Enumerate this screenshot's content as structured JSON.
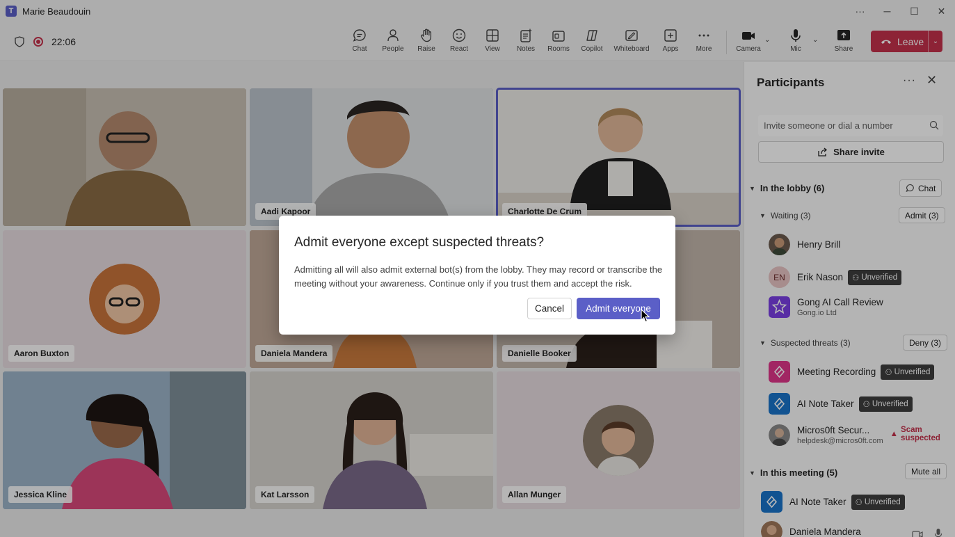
{
  "window": {
    "title": "Marie Beaudouin",
    "app_icon": "T"
  },
  "toolbar": {
    "timer": "22:06",
    "items": [
      {
        "id": "chat",
        "label": "Chat"
      },
      {
        "id": "people",
        "label": "People"
      },
      {
        "id": "raise",
        "label": "Raise"
      },
      {
        "id": "react",
        "label": "React"
      },
      {
        "id": "view",
        "label": "View"
      },
      {
        "id": "notes",
        "label": "Notes"
      },
      {
        "id": "rooms",
        "label": "Rooms"
      },
      {
        "id": "copilot",
        "label": "Copilot"
      },
      {
        "id": "whiteboard",
        "label": "Whiteboard"
      },
      {
        "id": "apps",
        "label": "Apps"
      },
      {
        "id": "more",
        "label": "More"
      },
      {
        "id": "camera",
        "label": "Camera"
      },
      {
        "id": "mic",
        "label": "Mic"
      },
      {
        "id": "share",
        "label": "Share"
      }
    ],
    "leave_label": "Leave",
    "accent": "#c4314b"
  },
  "stage": {
    "tiles": [
      {
        "name": "",
        "bg": "#a89a85"
      },
      {
        "name": "Aadi Kapoor",
        "bg": "#8a8f94"
      },
      {
        "name": "Charlotte De Crum",
        "bg": "#d9d6cf"
      },
      {
        "name": "Aaron Buxton",
        "bg": "#e6dcdf"
      },
      {
        "name": "Daniela Mandera",
        "bg": "#b59a86"
      },
      {
        "name": "Danielle Booker",
        "bg": "#9d8a7d"
      },
      {
        "name": "Jessica Kline",
        "bg": "#8fa3b8"
      },
      {
        "name": "Kat Larsson",
        "bg": "#c9c4bf"
      },
      {
        "name": "Allan Munger",
        "bg": "#e6dcdf"
      }
    ]
  },
  "participants": {
    "title": "Participants",
    "invite_placeholder": "Invite someone or dial a number",
    "share_invite": "Share invite",
    "lobby": {
      "label": "In the lobby (6)",
      "chat_label": "Chat",
      "waiting": {
        "label": "Waiting (3)",
        "action": "Admit (3)",
        "people": [
          {
            "name": "Henry Brill",
            "sub": "",
            "badge": "",
            "initials": "",
            "color": "#6b5a4e"
          },
          {
            "name": "Erik Nason",
            "sub": "",
            "badge": "Unverified",
            "initials": "EN",
            "color": "#e8c4c4"
          },
          {
            "name": "Gong AI Call Review",
            "sub": "Gong.io Ltd",
            "badge": "",
            "initials": "",
            "color": "#7b3fe4"
          }
        ]
      },
      "threats": {
        "label": "Suspected threats (3)",
        "action": "Deny (3)",
        "people": [
          {
            "name": "Meeting Recording",
            "sub": "",
            "badge": "Unverified",
            "color": "#e0358a"
          },
          {
            "name": "AI Note Taker",
            "sub": "",
            "badge": "Unverified",
            "color": "#1a73c9"
          },
          {
            "name": "Micros0ft Secur...",
            "sub": "helpdesk@micros0ft.com",
            "warning": "Scam suspected",
            "color": "#8a8a8a"
          }
        ]
      }
    },
    "meeting": {
      "label": "In this meeting (5)",
      "action": "Mute all",
      "people": [
        {
          "name": "AI Note Taker",
          "badge": "Unverified",
          "color": "#1a73c9"
        },
        {
          "name": "Daniela Mandera",
          "badge": "",
          "color": "#a0785a"
        }
      ]
    }
  },
  "dialog": {
    "title": "Admit everyone except suspected threats?",
    "body": "Admitting all will also admit external bot(s) from the lobby. They may record or transcribe the meeting without your awareness. Continue only if you trust them and accept the risk.",
    "cancel_label": "Cancel",
    "confirm_label": "Admit everyone",
    "accent": "#5b5fc7"
  }
}
